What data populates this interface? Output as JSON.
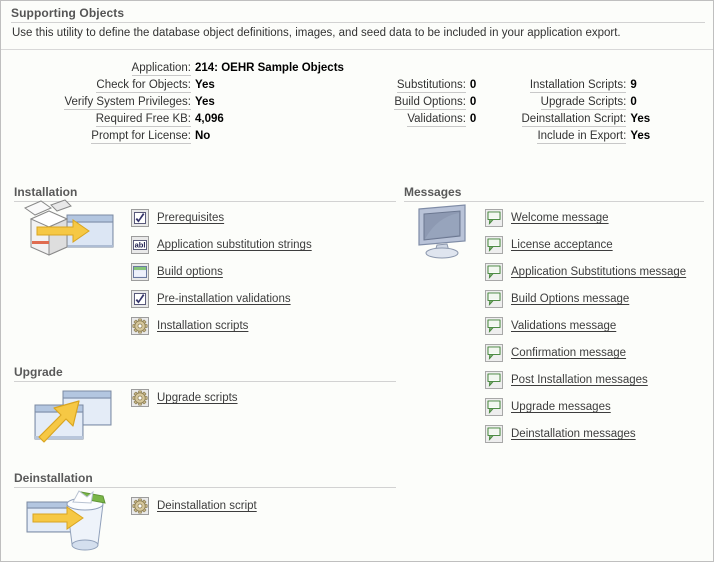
{
  "region": {
    "title": "Supporting Objects",
    "description": "Use this utility to define the database object definitions, images, and seed data to be included in your application export."
  },
  "attributes": {
    "application": {
      "label": "Application:",
      "value": "214: OEHR Sample Objects"
    },
    "col1": [
      {
        "label": "Check for Objects:",
        "value": "Yes"
      },
      {
        "label": "Verify System Privileges:",
        "value": "Yes"
      },
      {
        "label": "Required Free KB:",
        "value": "4,096"
      },
      {
        "label": "Prompt for License:",
        "value": "No"
      }
    ],
    "col2": [
      {
        "label": "Substitutions:",
        "value": "0"
      },
      {
        "label": "Build Options:",
        "value": "0"
      },
      {
        "label": "Validations:",
        "value": "0"
      },
      {
        "label": "",
        "value": ""
      }
    ],
    "col3": [
      {
        "label": "Installation Scripts:",
        "value": "9"
      },
      {
        "label": "Upgrade Scripts:",
        "value": "0"
      },
      {
        "label": "Deinstallation Script:",
        "value": "Yes"
      },
      {
        "label": "Include in Export:",
        "value": "Yes"
      }
    ]
  },
  "sections": {
    "installation": {
      "title": "Installation",
      "icon": "install-package-icon",
      "items": [
        {
          "label": "Prerequisites",
          "icon": "checkbox-icon"
        },
        {
          "label": "Application substitution strings",
          "icon": "abl-text-icon"
        },
        {
          "label": "Build options",
          "icon": "build-options-icon"
        },
        {
          "label": "Pre-installation validations",
          "icon": "checkbox-icon"
        },
        {
          "label": "Installation scripts",
          "icon": "gear-icon"
        }
      ]
    },
    "upgrade": {
      "title": "Upgrade",
      "icon": "upgrade-window-icon",
      "items": [
        {
          "label": "Upgrade scripts",
          "icon": "gear-icon"
        }
      ]
    },
    "deinstallation": {
      "title": "Deinstallation",
      "icon": "deinstall-trash-icon",
      "items": [
        {
          "label": "Deinstallation script",
          "icon": "gear-icon"
        }
      ]
    },
    "messages": {
      "title": "Messages",
      "icon": "monitor-icon",
      "items": [
        {
          "label": "Welcome message",
          "icon": "speech-bubble-icon"
        },
        {
          "label": "License acceptance",
          "icon": "speech-bubble-icon"
        },
        {
          "label": "Application Substitutions message",
          "icon": "speech-bubble-icon"
        },
        {
          "label": "Build Options message",
          "icon": "speech-bubble-icon"
        },
        {
          "label": "Validations message",
          "icon": "speech-bubble-icon"
        },
        {
          "label": "Confirmation message",
          "icon": "speech-bubble-icon"
        },
        {
          "label": "Post Installation messages",
          "icon": "speech-bubble-icon"
        },
        {
          "label": "Upgrade messages",
          "icon": "speech-bubble-icon"
        },
        {
          "label": "Deinstallation messages",
          "icon": "speech-bubble-icon"
        }
      ]
    }
  },
  "colors": {
    "background": "#fcfdfa",
    "border": "#bfbfbf",
    "rule": "#d2d2d2",
    "link": "#3d3d3d",
    "heading": "#595959",
    "accent_gold": "#f4c430",
    "accent_green": "#6aa84f",
    "accent_blue": "#a8bedd"
  }
}
